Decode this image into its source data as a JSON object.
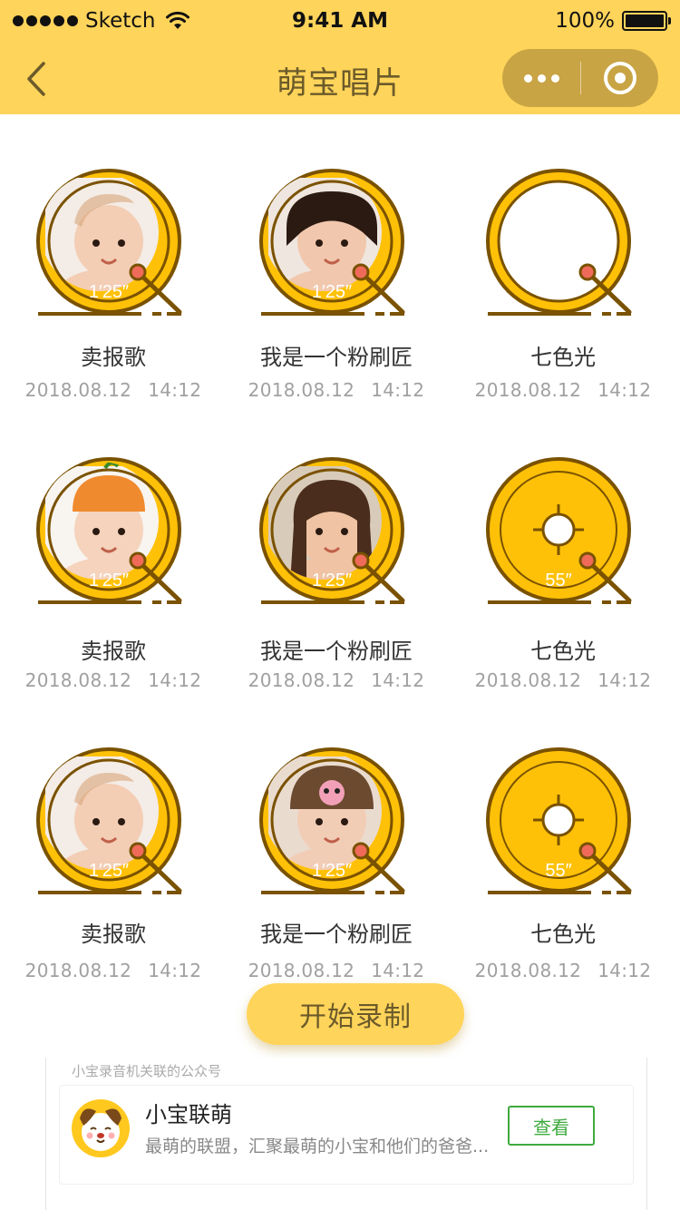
{
  "status_bar": {
    "carrier": "Sketch",
    "time": "9:41 AM",
    "battery": "100%"
  },
  "nav": {
    "title": "萌宝唱片",
    "back_icon": "chevron-left-icon",
    "more_icon": "more-dots-icon",
    "close_icon": "target-circle-icon"
  },
  "colors": {
    "accent": "#FFD45A",
    "record_gold": "#FFC107",
    "record_brown": "#7A5200",
    "needle_pink": "#F06A5A",
    "confirm_green": "#3EAA3E"
  },
  "records": [
    {
      "title": "卖报歌",
      "date": "2018.08.12",
      "time": "14:12",
      "duration": "1′25″",
      "art": "baby-photo"
    },
    {
      "title": "我是一个粉刷匠",
      "date": "2018.08.12",
      "time": "14:12",
      "duration": "1′25″",
      "art": "girl-photo"
    },
    {
      "title": "七色光",
      "date": "2018.08.12",
      "time": "14:12",
      "duration": "",
      "art": "empty"
    },
    {
      "title": "卖报歌",
      "date": "2018.08.12",
      "time": "14:12",
      "duration": "1′25″",
      "art": "baby-hat-photo"
    },
    {
      "title": "我是一个粉刷匠",
      "date": "2018.08.12",
      "time": "14:12",
      "duration": "1′25″",
      "art": "girl-long-hair-photo"
    },
    {
      "title": "七色光",
      "date": "2018.08.12",
      "time": "14:12",
      "duration": "55″",
      "art": "vinyl"
    },
    {
      "title": "卖报歌",
      "date": "2018.08.12",
      "time": "14:12",
      "duration": "1′25″",
      "art": "baby-photo"
    },
    {
      "title": "我是一个粉刷匠",
      "date": "2018.08.12",
      "time": "14:12",
      "duration": "1′25″",
      "art": "sleeping-baby-photo"
    },
    {
      "title": "七色光",
      "date": "2018.08.12",
      "time": "14:12",
      "duration": "55″",
      "art": "vinyl"
    }
  ],
  "record_button": {
    "label": "开始录制"
  },
  "official_account": {
    "caption": "小宝录音机关联的公众号",
    "name": "小宝联萌",
    "description": "最萌的联盟，汇聚最萌的小宝和他们的爸爸...",
    "view_label": "查看",
    "avatar_icon": "cartoon-dog-avatar"
  }
}
